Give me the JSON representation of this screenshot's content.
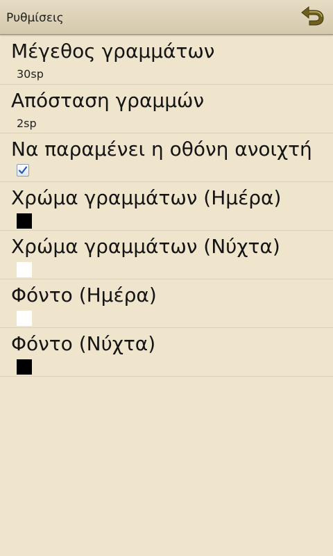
{
  "actionbar": {
    "title": "Ρυθμίσεις",
    "back_icon": "undo-arrow-icon",
    "accent": "#6e5f1c"
  },
  "preferences": [
    {
      "title": "Μέγεθος γραμμάτων",
      "summary": "30sp"
    },
    {
      "title": "Απόσταση γραμμών",
      "summary": "2sp"
    },
    {
      "title": "Να παραμένει η οθόνη ανοιχτή",
      "checked": true
    },
    {
      "title": "Χρώμα γραμμάτων (Ημέρα)",
      "color": "#000000"
    },
    {
      "title": "Χρώμα γραμμάτων (Νύχτα)",
      "color": "#ffffff"
    },
    {
      "title": "Φόντο (Ημέρα)",
      "color": "#ffffff"
    },
    {
      "title": "Φόντο (Νύχτα)",
      "color": "#000000"
    }
  ]
}
